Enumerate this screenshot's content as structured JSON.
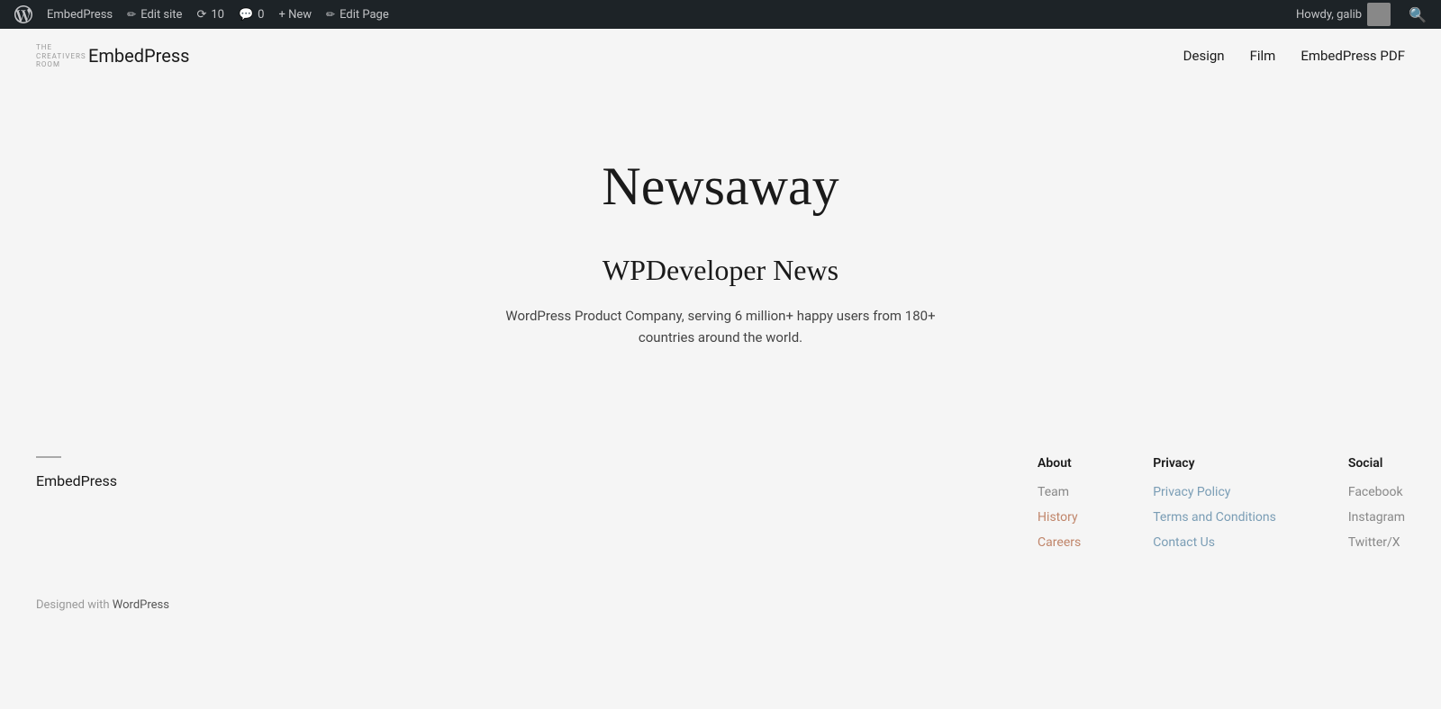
{
  "adminbar": {
    "wp_logo_label": "WordPress",
    "site_name": "EmbedPress",
    "edit_site_label": "Edit site",
    "updates_count": "10",
    "comments_count": "0",
    "new_label": "+ New",
    "edit_page_label": "Edit Page",
    "howdy_text": "Howdy, galib",
    "search_icon": "🔍"
  },
  "header": {
    "logo_small_text": "THE CREATIVERS ROOM",
    "site_title": "EmbedPress",
    "nav": [
      {
        "label": "Design"
      },
      {
        "label": "Film"
      },
      {
        "label": "EmbedPress PDF"
      }
    ]
  },
  "main": {
    "hero_title": "Newsaway",
    "hero_subtitle": "WPDeveloper News",
    "hero_description": "WordPress Product Company, serving 6 million+ happy users from 180+ countries around the world."
  },
  "footer": {
    "brand_name": "EmbedPress",
    "about_col": {
      "title": "About",
      "links": [
        {
          "label": "Team",
          "color": "default"
        },
        {
          "label": "History",
          "color": "muted-red"
        },
        {
          "label": "Careers",
          "color": "muted-red"
        }
      ]
    },
    "privacy_col": {
      "title": "Privacy",
      "links": [
        {
          "label": "Privacy Policy",
          "color": "muted-blue"
        },
        {
          "label": "Terms and Conditions",
          "color": "muted-blue"
        },
        {
          "label": "Contact Us",
          "color": "muted-blue"
        }
      ]
    },
    "social_col": {
      "title": "Social",
      "links": [
        {
          "label": "Facebook",
          "color": "default"
        },
        {
          "label": "Instagram",
          "color": "default"
        },
        {
          "label": "Twitter/X",
          "color": "default"
        }
      ]
    },
    "designed_with": "Designed with ",
    "wordpress_link": "WordPress"
  }
}
